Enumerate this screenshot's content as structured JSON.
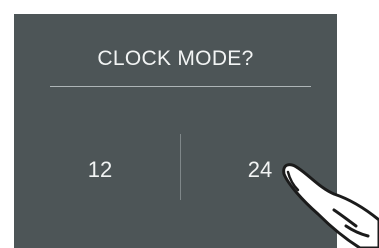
{
  "dialog": {
    "title": "CLOCK MODE?",
    "options": [
      {
        "label": "12"
      },
      {
        "label": "24"
      }
    ]
  },
  "colors": {
    "panel_background": "#4d5557",
    "text": "#f2f4f4",
    "rule": "#aeb5b7",
    "divider": "#7f8789"
  },
  "icons": {
    "pointer": "pointing-finger-icon"
  }
}
